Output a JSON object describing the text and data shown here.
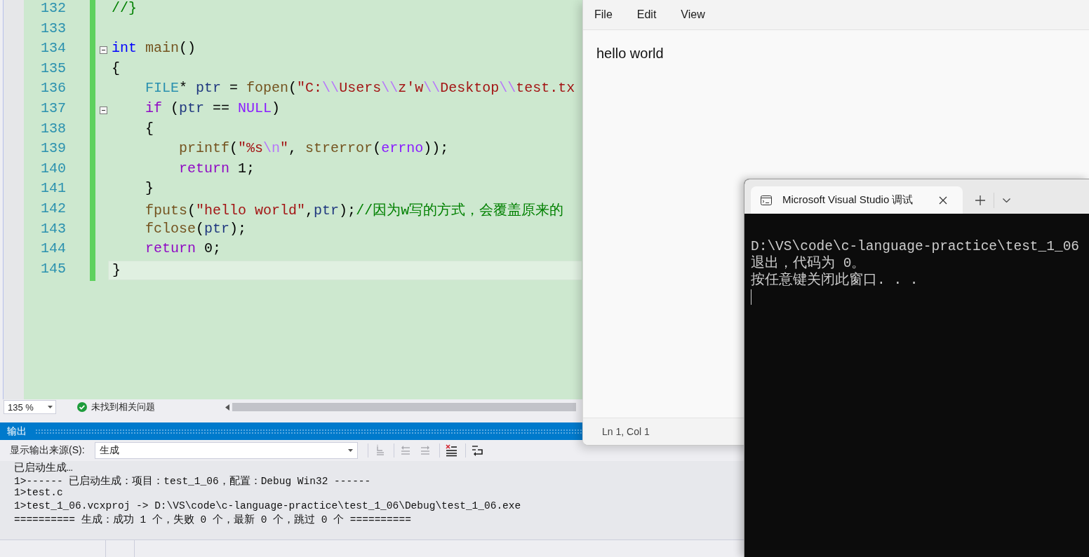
{
  "editor": {
    "lines": [
      {
        "number": "132",
        "foldable": false,
        "current": false,
        "tokens": [
          {
            "kind": "comment",
            "text": "//}"
          }
        ]
      },
      {
        "number": "133",
        "foldable": false,
        "current": false
      },
      {
        "number": "134",
        "foldable": true,
        "current": false,
        "tokens": [
          {
            "kind": "keyword",
            "text": "int"
          },
          {
            "kind": "function",
            "text": " main"
          },
          {
            "kind": "plain",
            "text": "()"
          }
        ]
      },
      {
        "number": "135",
        "foldable": false,
        "current": false,
        "tokens": [
          {
            "kind": "plain",
            "text": "{"
          }
        ]
      },
      {
        "number": "136",
        "foldable": false,
        "current": false,
        "tokens": [
          {
            "kind": "type",
            "text": "    FILE"
          },
          {
            "kind": "plain",
            "text": "* "
          },
          {
            "kind": "variable",
            "text": "ptr"
          },
          {
            "kind": "plain",
            "text": " = "
          },
          {
            "kind": "function",
            "text": "fopen"
          },
          {
            "kind": "plain",
            "text": "("
          },
          {
            "kind": "string",
            "text": "\"C:"
          },
          {
            "kind": "escape",
            "text": "\\\\"
          },
          {
            "kind": "string",
            "text": "Users"
          },
          {
            "kind": "escape",
            "text": "\\\\"
          },
          {
            "kind": "string",
            "text": "z'w"
          },
          {
            "kind": "escape",
            "text": "\\\\"
          },
          {
            "kind": "string",
            "text": "Desktop"
          },
          {
            "kind": "escape",
            "text": "\\\\"
          },
          {
            "kind": "string",
            "text": "test.tx"
          }
        ]
      },
      {
        "number": "137",
        "foldable": true,
        "current": false,
        "tokens": [
          {
            "kind": "control",
            "text": "    if"
          },
          {
            "kind": "plain",
            "text": " ("
          },
          {
            "kind": "variable",
            "text": "ptr"
          },
          {
            "kind": "plain",
            "text": " == "
          },
          {
            "kind": "macro",
            "text": "NULL"
          },
          {
            "kind": "plain",
            "text": ")"
          }
        ]
      },
      {
        "number": "138",
        "foldable": false,
        "current": false,
        "tokens": [
          {
            "kind": "plain",
            "text": "    {"
          }
        ]
      },
      {
        "number": "139",
        "foldable": false,
        "current": false,
        "tokens": [
          {
            "kind": "function",
            "text": "        printf"
          },
          {
            "kind": "plain",
            "text": "("
          },
          {
            "kind": "string",
            "text": "\"%s"
          },
          {
            "kind": "escape",
            "text": "\\n"
          },
          {
            "kind": "string",
            "text": "\""
          },
          {
            "kind": "plain",
            "text": ", "
          },
          {
            "kind": "function",
            "text": "strerror"
          },
          {
            "kind": "plain",
            "text": "("
          },
          {
            "kind": "macro",
            "text": "errno"
          },
          {
            "kind": "plain",
            "text": "));"
          }
        ]
      },
      {
        "number": "140",
        "foldable": false,
        "current": false,
        "tokens": [
          {
            "kind": "control",
            "text": "        return"
          },
          {
            "kind": "plain",
            "text": " 1;"
          }
        ]
      },
      {
        "number": "141",
        "foldable": false,
        "current": false,
        "tokens": [
          {
            "kind": "plain",
            "text": "    }"
          }
        ]
      },
      {
        "number": "142",
        "foldable": false,
        "current": false,
        "tokens": [
          {
            "kind": "function",
            "text": "    fputs"
          },
          {
            "kind": "plain",
            "text": "("
          },
          {
            "kind": "string",
            "text": "\"hello world\""
          },
          {
            "kind": "plain",
            "text": ","
          },
          {
            "kind": "variable",
            "text": "ptr"
          },
          {
            "kind": "plain",
            "text": ");"
          },
          {
            "kind": "comment",
            "text": "//因为w写的方式，会覆盖原来的"
          }
        ]
      },
      {
        "number": "143",
        "foldable": false,
        "current": false,
        "tokens": [
          {
            "kind": "function",
            "text": "    fclose"
          },
          {
            "kind": "plain",
            "text": "("
          },
          {
            "kind": "variable",
            "text": "ptr"
          },
          {
            "kind": "plain",
            "text": ");"
          }
        ]
      },
      {
        "number": "144",
        "foldable": false,
        "current": false,
        "tokens": [
          {
            "kind": "control",
            "text": "    return"
          },
          {
            "kind": "plain",
            "text": " 0;"
          }
        ]
      },
      {
        "number": "145",
        "foldable": false,
        "current": true,
        "tokens": [
          {
            "kind": "plain",
            "text": "}"
          }
        ]
      }
    ]
  },
  "status_row": {
    "zoom": "135 %",
    "issues": "未找到相关问题"
  },
  "output_panel": {
    "title": "输出",
    "source_label": "显示输出来源(S):",
    "source": "生成",
    "tools": [
      {
        "kind": "goto",
        "disabled": true
      },
      {
        "kind": "previous",
        "disabled": true
      },
      {
        "kind": "next",
        "disabled": true
      },
      {
        "kind": "clear",
        "disabled": false
      },
      {
        "kind": "wrap",
        "disabled": false
      }
    ],
    "lines": [
      "已启动生成…",
      "1>------ 已启动生成：项目：test_1_06，配置：Debug Win32 ------",
      "1>test.c",
      "1>test_1_06.vcxproj -> D:\\VS\\code\\c-language-practice\\test_1_06\\Debug\\test_1_06.exe",
      "========== 生成：成功 1 个，失败 0 个，最新 0 个，跳过 0 个 =========="
    ]
  },
  "notepad": {
    "menu": [
      "File",
      "Edit",
      "View"
    ],
    "text": "hello world",
    "status": "Ln 1, Col 1"
  },
  "terminal": {
    "tab_title": "Microsoft Visual Studio 调试",
    "lines": [
      "D:\\VS\\code\\c-language-practice\\test_1_06",
      "退出，代码为 0。",
      "按任意键关闭此窗口. . ."
    ]
  }
}
